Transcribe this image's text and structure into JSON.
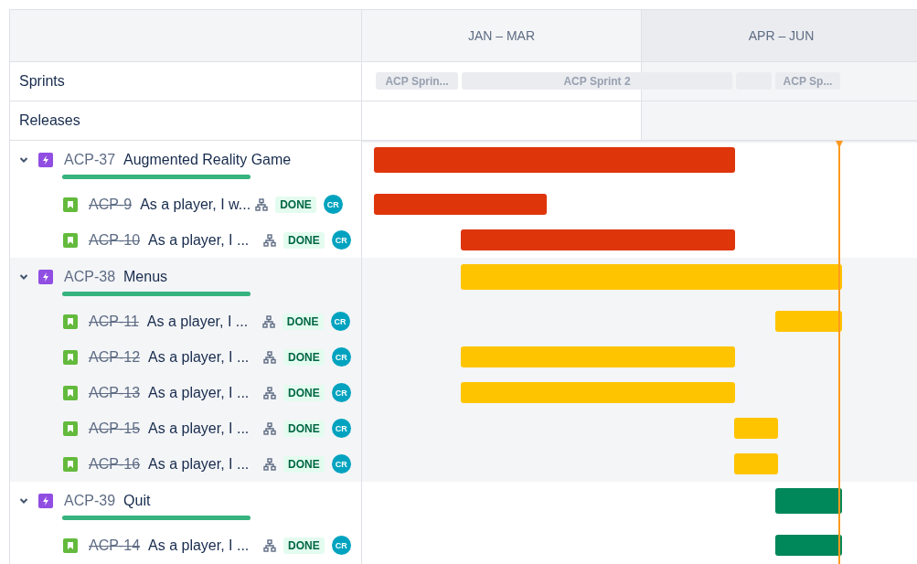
{
  "timeline": {
    "columns": [
      {
        "label": "JAN – MAR"
      },
      {
        "label": "APR – JUN"
      }
    ]
  },
  "sprints": {
    "label": "Sprints",
    "items": [
      {
        "kind": "named",
        "label": "ACP Sprin..."
      },
      {
        "kind": "named",
        "label": "ACP Sprint 2"
      },
      {
        "kind": "unnamed"
      },
      {
        "kind": "named",
        "label": "ACP Sp..."
      }
    ]
  },
  "releases": {
    "label": "Releases"
  },
  "epics": [
    {
      "key": "ACP-37",
      "title": "Augmented Reality Game",
      "expanded": true,
      "level": 1,
      "color": "#de350b",
      "children": [
        {
          "key": "ACP-9",
          "summary": "As a player, I w...",
          "done": true,
          "status": "DONE",
          "assignee": "CR"
        },
        {
          "key": "ACP-10",
          "summary": "As a player, I ...",
          "done": true,
          "status": "DONE",
          "assignee": "CR"
        }
      ]
    },
    {
      "key": "ACP-38",
      "title": "Menus",
      "expanded": true,
      "level": 1,
      "color": "#ffc400",
      "children": [
        {
          "key": "ACP-11",
          "summary": "As a player, I ...",
          "done": true,
          "status": "DONE",
          "assignee": "CR"
        },
        {
          "key": "ACP-12",
          "summary": "As a player, I ...",
          "done": true,
          "status": "DONE",
          "assignee": "CR"
        },
        {
          "key": "ACP-13",
          "summary": "As a player, I ...",
          "done": true,
          "status": "DONE",
          "assignee": "CR"
        },
        {
          "key": "ACP-15",
          "summary": "As a player, I ...",
          "done": true,
          "status": "DONE",
          "assignee": "CR"
        },
        {
          "key": "ACP-16",
          "summary": "As a player, I ...",
          "done": true,
          "status": "DONE",
          "assignee": "CR"
        }
      ]
    },
    {
      "key": "ACP-39",
      "title": "Quit",
      "expanded": true,
      "level": 1,
      "color": "#00875a",
      "children": [
        {
          "key": "ACP-14",
          "summary": "As a player, I ...",
          "done": true,
          "status": "DONE",
          "assignee": "CR"
        }
      ]
    }
  ]
}
